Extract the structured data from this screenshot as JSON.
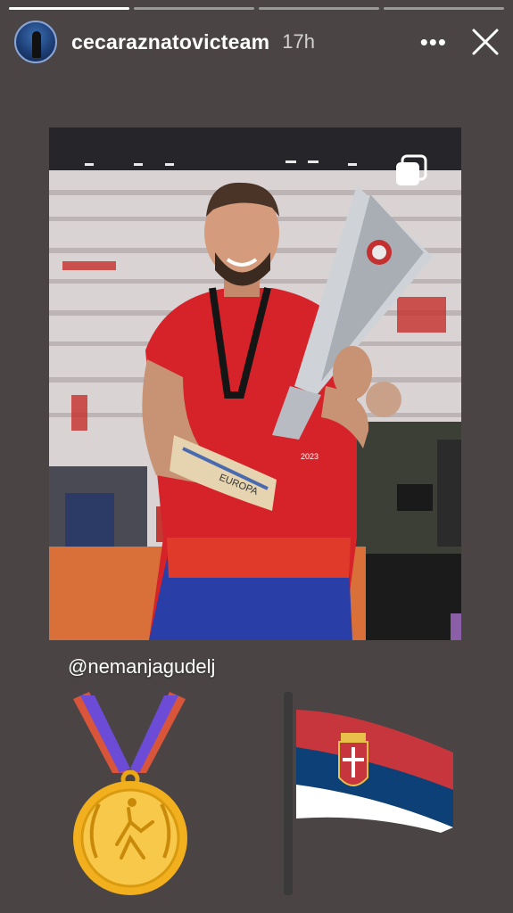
{
  "story": {
    "progress_segments": 4,
    "progress_current": 1
  },
  "header": {
    "username": "cecaraznatovicteam",
    "timestamp": "17h",
    "more_glyph": "•••"
  },
  "post": {
    "mention": "@nemanjagudelj",
    "trophy_text": "EUROPA",
    "trophy_year": "2023"
  },
  "stickers": {
    "medal": "medal-sticker",
    "flag": "serbia-flag-sticker"
  },
  "colors": {
    "background": "#4a4544",
    "shirt_red": "#d6232a",
    "flag_red": "#c6363c",
    "flag_blue": "#0c4076",
    "flag_white": "#ffffff",
    "gold": "#f2b01e"
  }
}
